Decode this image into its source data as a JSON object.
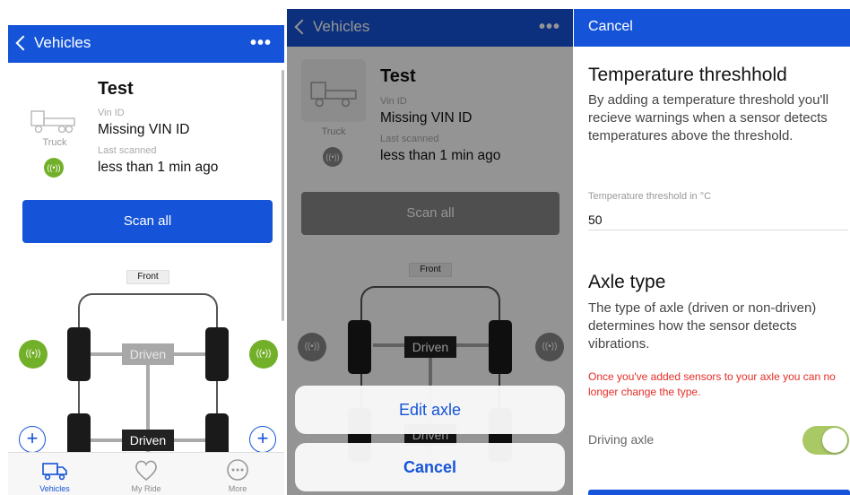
{
  "colors": {
    "brand": "#1554d8",
    "signal": "#73b02a",
    "warning": "#e52d27",
    "toggle_on": "#a8c964"
  },
  "screen1": {
    "nav": {
      "back_label": "Vehicles",
      "more_label": "•••"
    },
    "vehicle": {
      "name": "Test",
      "type": "Truck",
      "vin_label": "Vin ID",
      "vin_value": "Missing VIN ID",
      "scanned_label": "Last scanned",
      "scanned_value": "less than 1 min ago"
    },
    "scan_all_label": "Scan all",
    "diagram": {
      "front_label": "Front",
      "axle1_label": "Driven",
      "axle2_label": "Driven",
      "signal_icon": "((•))",
      "add_icon": "+"
    },
    "tabs": [
      {
        "label": "Vehicles",
        "icon": "truck-icon"
      },
      {
        "label": "My Ride",
        "icon": "heart-icon"
      },
      {
        "label": "More",
        "icon": "more-icon"
      }
    ]
  },
  "screen2": {
    "nav": {
      "back_label": "Vehicles",
      "more_label": "•••"
    },
    "vehicle": {
      "name": "Test",
      "type": "Truck",
      "vin_label": "Vin ID",
      "vin_value": "Missing VIN ID",
      "scanned_label": "Last scanned",
      "scanned_value": "less than 1 min ago"
    },
    "scan_all_label": "Scan all",
    "diagram": {
      "front_label": "Front",
      "axle1_label": "Driven",
      "axle2_label": "Driven"
    },
    "action_sheet": {
      "edit_label": "Edit axle",
      "cancel_label": "Cancel"
    }
  },
  "screen3": {
    "nav": {
      "cancel_label": "Cancel"
    },
    "temperature": {
      "title": "Temperature threshhold",
      "description": "By adding a temperature threshold you'll recieve warnings when a sensor detects temperatures above the threshold.",
      "field_label": "Temperature threshold in °C",
      "field_value": "50"
    },
    "axle": {
      "title": "Axle type",
      "description": "The type of axle (driven or non-driven) determines how the sensor detects vibrations.",
      "warning": "Once you've added sensors to your axle you can no longer change the type.",
      "toggle_label": "Driving axle",
      "toggle_on": true
    }
  }
}
